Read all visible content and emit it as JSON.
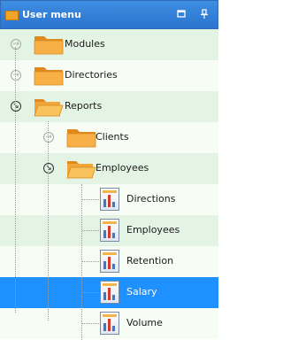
{
  "header": {
    "title": "User menu",
    "buttons": [
      "window-icon",
      "pin-icon"
    ]
  },
  "colors": {
    "header_bg": "#3582da",
    "row_green": "#e4f4e4",
    "row_light": "#f7fcf5",
    "selected_bg": "#1e90ff",
    "folder": "#f4a53a"
  },
  "tree": [
    {
      "label": "Modules",
      "level": 0,
      "type": "folder",
      "expanded": false
    },
    {
      "label": "Directories",
      "level": 0,
      "type": "folder",
      "expanded": false
    },
    {
      "label": "Reports",
      "level": 0,
      "type": "folder",
      "expanded": true
    },
    {
      "label": "Clients",
      "level": 1,
      "type": "folder",
      "expanded": false
    },
    {
      "label": "Employees",
      "level": 1,
      "type": "folder",
      "expanded": true
    },
    {
      "label": "Directions",
      "level": 2,
      "type": "report"
    },
    {
      "label": "Employees",
      "level": 2,
      "type": "report"
    },
    {
      "label": "Retention",
      "level": 2,
      "type": "report"
    },
    {
      "label": "Salary",
      "level": 2,
      "type": "report",
      "selected": true
    },
    {
      "label": "Volume",
      "level": 2,
      "type": "report"
    }
  ]
}
